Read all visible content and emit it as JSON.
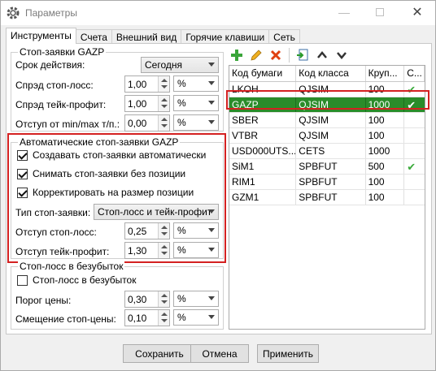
{
  "window": {
    "title": "Параметры",
    "minimize": "—",
    "close": "✕"
  },
  "tabs": [
    {
      "label": "Инструменты"
    },
    {
      "label": "Счета"
    },
    {
      "label": "Внешний вид"
    },
    {
      "label": "Горячие клавиши"
    },
    {
      "label": "Сеть"
    }
  ],
  "stop_group": {
    "title": "Стоп-заявки GAZP",
    "validity_label": "Срок действия:",
    "validity_value": "Сегодня",
    "sl_spread_label": "Спрэд стоп-лосс:",
    "sl_spread_value": "1,00",
    "sl_spread_unit": "%",
    "tp_spread_label": "Спрэд тейк-профит:",
    "tp_spread_value": "1,00",
    "tp_spread_unit": "%",
    "minmax_label": "Отступ от min/max т/п.:",
    "minmax_value": "0,00",
    "minmax_unit": "%"
  },
  "auto_group": {
    "title": "Автоматические стоп-заявки GAZP",
    "create_auto": {
      "label": "Создавать стоп-заявки автоматически",
      "checked": true
    },
    "remove_no_pos": {
      "label": "Снимать стоп-заявки без позиции",
      "checked": true
    },
    "adjust_pos": {
      "label": "Корректировать на размер позиции",
      "checked": true
    },
    "type_label": "Тип стоп-заявки:",
    "type_value": "Стоп-лосс и тейк-профит",
    "sl_offset_label": "Отступ стоп-лосс:",
    "sl_offset_value": "0,25",
    "sl_offset_unit": "%",
    "tp_offset_label": "Отступ тейк-профит:",
    "tp_offset_value": "1,30",
    "tp_offset_unit": "%"
  },
  "breakeven_group": {
    "title": "Стоп-лосс в безубыток",
    "enable": {
      "label": "Стоп-лосс в безубыток",
      "checked": false
    },
    "threshold_label": "Порог цены:",
    "threshold_value": "0,30",
    "threshold_unit": "%",
    "shift_label": "Смещение стоп-цены:",
    "shift_value": "0,10",
    "shift_unit": "%"
  },
  "toolbar": {
    "icons": [
      "add-icon",
      "edit-icon",
      "delete-icon",
      "import-icon",
      "move-up-icon",
      "move-down-icon"
    ]
  },
  "grid": {
    "columns": [
      "Код бумаги",
      "Код класса",
      "Круп...",
      "С..."
    ],
    "rows": [
      {
        "code": "LKOH",
        "class": "QJSIM",
        "lot": "100",
        "mark": "✔"
      },
      {
        "code": "GAZP",
        "class": "QJSIM",
        "lot": "1000",
        "mark": "✔"
      },
      {
        "code": "SBER",
        "class": "QJSIM",
        "lot": "100",
        "mark": ""
      },
      {
        "code": "VTBR",
        "class": "QJSIM",
        "lot": "100",
        "mark": ""
      },
      {
        "code": "USD000UTS...",
        "class": "CETS",
        "lot": "1000",
        "mark": ""
      },
      {
        "code": "SiM1",
        "class": "SPBFUT",
        "lot": "500",
        "mark": "✔"
      },
      {
        "code": "RIM1",
        "class": "SPBFUT",
        "lot": "100",
        "mark": ""
      },
      {
        "code": "GZM1",
        "class": "SPBFUT",
        "lot": "100",
        "mark": ""
      }
    ],
    "selected_row": 1
  },
  "buttons": {
    "save": "Сохранить",
    "cancel": "Отмена",
    "apply": "Применить"
  },
  "colors": {
    "selection": "#2a8c2a",
    "highlight": "#d42121",
    "tick": "#3aaa3a"
  }
}
